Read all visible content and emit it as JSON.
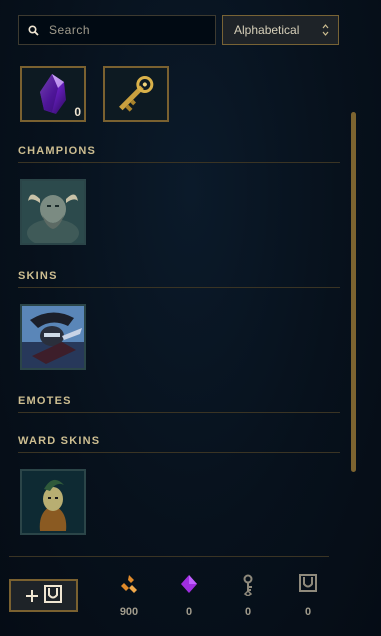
{
  "search": {
    "placeholder": "Search"
  },
  "sort": {
    "selected": "Alphabetical"
  },
  "loot_tiles": [
    {
      "icon": "mythic-essence-icon",
      "count": "0"
    },
    {
      "icon": "hextech-key-icon",
      "count": ""
    }
  ],
  "sections": [
    {
      "title": "CHAMPIONS",
      "items": [
        {
          "icon": "champion-olaf-thumb"
        }
      ]
    },
    {
      "title": "SKINS",
      "items": [
        {
          "icon": "skin-thumb"
        }
      ]
    },
    {
      "title": "EMOTES",
      "items": []
    },
    {
      "title": "WARD SKINS",
      "items": [
        {
          "icon": "ward-skin-thumb"
        }
      ]
    }
  ],
  "wallet": {
    "craft_icon": "plus-chest-icon",
    "items": [
      {
        "icon": "orange-essence-icon",
        "value": "900",
        "color": "#e08a2a"
      },
      {
        "icon": "mythic-essence-icon",
        "value": "0",
        "color": "#a02ee0"
      },
      {
        "icon": "key-fragment-icon",
        "value": "0",
        "color": "#8f8a7c"
      },
      {
        "icon": "chest-icon",
        "value": "0",
        "color": "#8f8a7c"
      }
    ]
  },
  "colors": {
    "gold": "#cdbe91",
    "border_gold": "#7a6130",
    "background": "#07111c"
  }
}
